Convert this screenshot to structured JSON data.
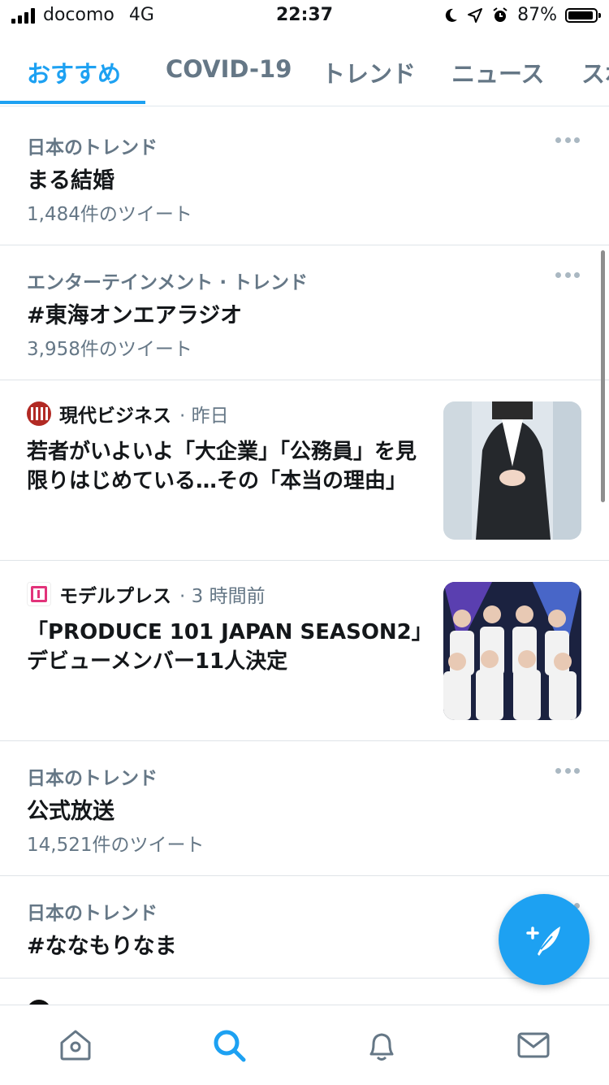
{
  "status_bar": {
    "carrier": "docomo",
    "network": "4G",
    "time": "22:37",
    "battery": "87%"
  },
  "tabs": [
    {
      "label": "おすすめ",
      "active": true
    },
    {
      "label": "COVID-19",
      "active": false
    },
    {
      "label": "トレンド",
      "active": false
    },
    {
      "label": "ニュース",
      "active": false
    },
    {
      "label": "スポ",
      "active": false
    }
  ],
  "feed": {
    "trend1": {
      "context": "日本のトレンド",
      "name": "まる結婚",
      "count": "1,484件のツイート"
    },
    "trend2": {
      "context": "エンターテインメント · トレンド",
      "name": "#東海オンエアラジオ",
      "count": "3,958件のツイート"
    },
    "news1": {
      "source": "現代ビジネス",
      "time": "· 昨日",
      "headline": "若者がいよいよ「大企業」「公務員」を見限りはじめている…その「本当の理由」"
    },
    "news2": {
      "source": "モデルプレス",
      "time": "· 3 時間前",
      "headline": "「PRODUCE 101 JAPAN SEASON2」デビューメンバー11人決定"
    },
    "trend3": {
      "context": "日本のトレンド",
      "name": "公式放送",
      "count": "14,521件のツイート"
    },
    "trend4": {
      "context": "日本のトレンド",
      "name": "#ななもりなま"
    }
  },
  "bottom_nav": [
    "home-icon",
    "search-icon",
    "notifications-icon",
    "messages-icon"
  ],
  "colors": {
    "accent": "#1da1f2",
    "secondary_text": "#657786",
    "divider": "#dfe4e8"
  }
}
